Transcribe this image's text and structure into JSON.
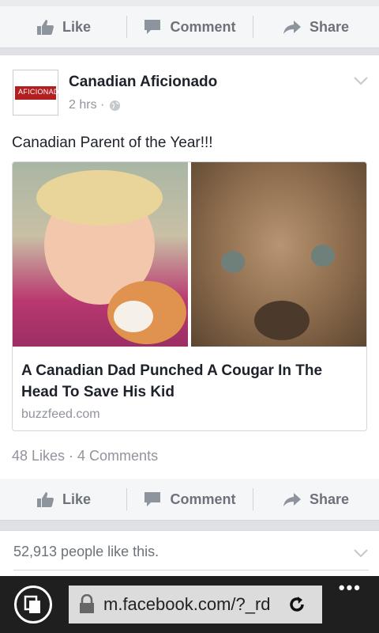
{
  "actions": {
    "like": "Like",
    "comment": "Comment",
    "share": "Share"
  },
  "post": {
    "page_name": "Canadian Aficionado",
    "avatar_text": "AFICIONADO",
    "time": "2 hrs ·",
    "text": "Canadian Parent of the Year!!!",
    "link_title": "A Canadian Dad Punched A Cougar In The Head To Save His Kid",
    "link_domain": "buzzfeed.com",
    "counts": "48 Likes · 4 Comments"
  },
  "page_likes": "52,913 people like this.",
  "browser": {
    "url": "m.facebook.com/?_rd",
    "more": "•••"
  },
  "colors": {
    "accent_red": "#b41e1e",
    "text": "#1d2129",
    "muted": "#90949c"
  }
}
